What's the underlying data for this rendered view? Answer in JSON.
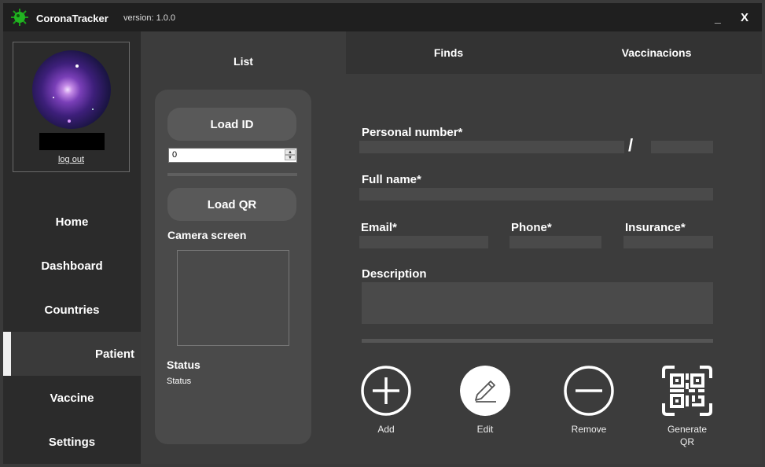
{
  "window": {
    "title": "CoronaTracker",
    "version": "version: 1.0.0",
    "minimize": "_",
    "close": "X"
  },
  "profile": {
    "logout": "log out"
  },
  "nav": {
    "home": "Home",
    "dashboard": "Dashboard",
    "countries": "Countries",
    "patient": "Patient",
    "vaccine": "Vaccine",
    "settings": "Settings"
  },
  "tabs": {
    "list": "List",
    "finds": "Finds",
    "vaccinations": "Vaccinacions"
  },
  "left_panel": {
    "load_id": "Load ID",
    "id_value": "0",
    "load_qr": "Load QR",
    "camera_label": "Camera screen",
    "status_heading": "Status",
    "status_value": "Status"
  },
  "form": {
    "personal_number": "Personal number*",
    "slash": "/",
    "full_name": "Full name*",
    "email": "Email*",
    "phone": "Phone*",
    "insurance": "Insurance*",
    "description": "Description"
  },
  "actions": {
    "add": "Add",
    "edit": "Edit",
    "remove": "Remove",
    "generate_qr_line1": "Generate",
    "generate_qr_line2": "QR"
  }
}
